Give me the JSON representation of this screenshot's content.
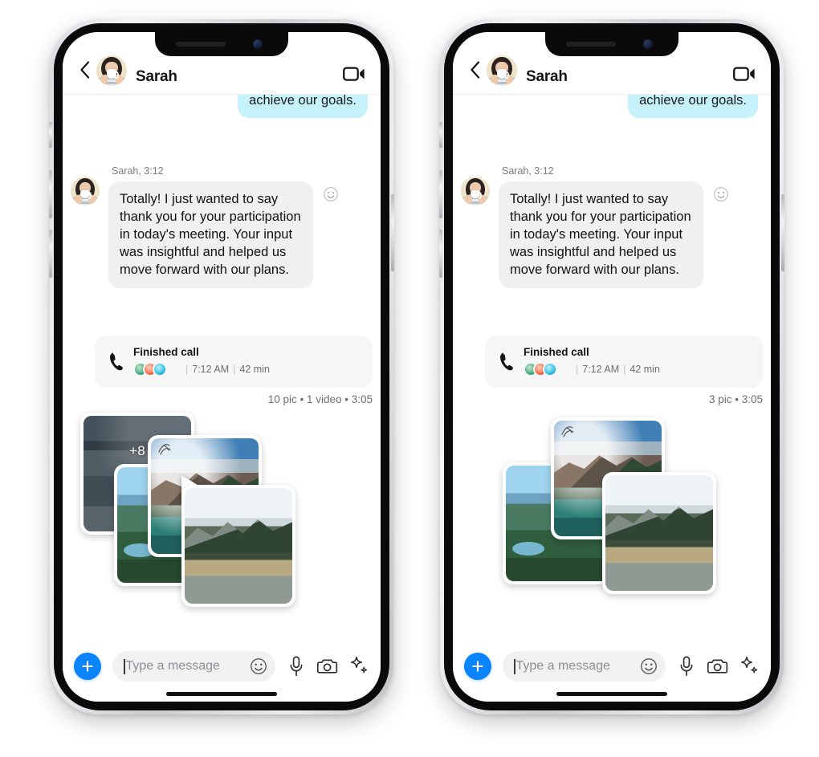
{
  "app": {
    "name": "Messaging App",
    "platform": "iPhone"
  },
  "colors": {
    "accent_blue": "#0a84ff",
    "outgoing_bubble": "#c6f2fc",
    "incoming_bubble": "#f0f0f0",
    "call_card_bg": "#f6f6f6",
    "input_pill_bg": "#f1f1f2",
    "meta_text": "#6e6e6e"
  },
  "header": {
    "back_label": "Back",
    "contact_name": "Sarah",
    "avatar_name": "Sarah",
    "video_call_label": "Video call"
  },
  "conversation": {
    "outgoing_message": {
      "text": "achieve our goals.",
      "clipped": true
    },
    "incoming_message": {
      "sender": "Sarah",
      "time": "3:12",
      "meta": "Sarah, 3:12",
      "text": "Totally! I just wanted to say thank you for your participation in today's meeting. Your input was insightful and helped us move forward with our plans.",
      "reaction_label": "Add reaction"
    },
    "call_card": {
      "title": "Finished call",
      "participants": 3,
      "time": "7:12 AM",
      "duration": "42 min",
      "separator": "|"
    }
  },
  "phones": [
    {
      "variant": "left",
      "media": {
        "label": "10 pic • 1 video • 3:05",
        "pic_count": 10,
        "video_count": 1,
        "timestamp": "3:05",
        "more_badge": "+8",
        "has_video": true,
        "cards": [
          {
            "name": "lake-dim",
            "style": "pic-lake",
            "badge": "+8"
          },
          {
            "name": "valley",
            "style": "pic-valley",
            "badge": ""
          },
          {
            "name": "peak-video",
            "style": "pic-peak",
            "badge": "",
            "play": true
          },
          {
            "name": "mirror-lake",
            "style": "pic-mirror",
            "badge": ""
          }
        ]
      }
    },
    {
      "variant": "right",
      "media": {
        "label": "3 pic • 3:05",
        "pic_count": 3,
        "video_count": 0,
        "timestamp": "3:05",
        "more_badge": "",
        "has_video": false,
        "cards": [
          {
            "name": "valley",
            "style": "pic-valley",
            "badge": ""
          },
          {
            "name": "peak",
            "style": "pic-peak",
            "badge": ""
          },
          {
            "name": "mirror-lake",
            "style": "pic-mirror",
            "badge": ""
          }
        ]
      }
    }
  ],
  "composer": {
    "add_label": "+",
    "placeholder": "Type a message",
    "input_value": "",
    "emoji_label": "Emoji",
    "mic_label": "Voice message",
    "camera_label": "Camera",
    "ai_label": "AI suggestions"
  }
}
